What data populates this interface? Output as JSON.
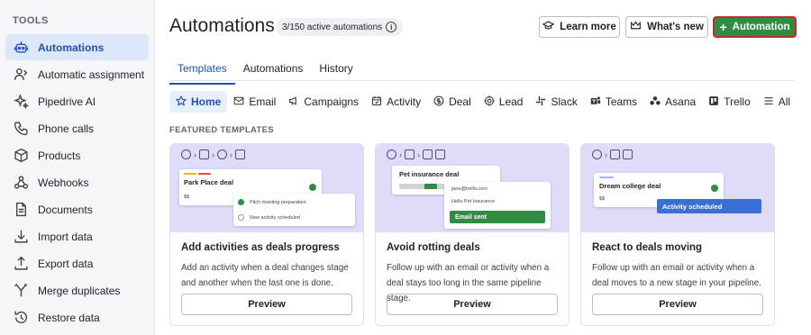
{
  "sidebar": {
    "section": "TOOLS",
    "items": [
      {
        "label": "Automations",
        "icon": "robot-icon",
        "active": true
      },
      {
        "label": "Automatic assignment",
        "icon": "assignment-icon"
      },
      {
        "label": "Pipedrive AI",
        "icon": "sparkle-icon"
      },
      {
        "label": "Phone calls",
        "icon": "phone-icon"
      },
      {
        "label": "Products",
        "icon": "box-icon"
      },
      {
        "label": "Webhooks",
        "icon": "webhook-icon"
      },
      {
        "label": "Documents",
        "icon": "document-icon"
      },
      {
        "label": "Import data",
        "icon": "import-icon"
      },
      {
        "label": "Export data",
        "icon": "export-icon"
      },
      {
        "label": "Merge duplicates",
        "icon": "merge-icon"
      },
      {
        "label": "Restore data",
        "icon": "restore-icon"
      }
    ]
  },
  "header": {
    "title": "Automations",
    "active_count": "3/150 active automations",
    "learn_more": "Learn more",
    "whats_new": "What's new",
    "add_automation": "Automation"
  },
  "tabs": [
    "Templates",
    "Automations",
    "History"
  ],
  "filters": [
    "Home",
    "Email",
    "Campaigns",
    "Activity",
    "Deal",
    "Lead",
    "Slack",
    "Teams",
    "Asana",
    "Trello",
    "All"
  ],
  "featured_label": "FEATURED TEMPLATES",
  "cards": [
    {
      "title": "Add activities as deals progress",
      "description": "Add an activity when a deal changes stage and another when the last one is done.",
      "button": "Preview",
      "illustration": {
        "deal": "Park Place deal",
        "amount": "$$",
        "activity1": "Pitch meeting preparation",
        "activity2": "New activity scheduled"
      }
    },
    {
      "title": "Avoid rotting deals",
      "description": "Follow up with an email or activity when a deal stays too long in the same pipeline stage.",
      "button": "Preview",
      "illustration": {
        "deal": "Pet insurance deal",
        "email_from": "jane@trello.com",
        "email_subject": "Hello Pet Insurance",
        "status": "Email sent"
      }
    },
    {
      "title": "React to deals moving",
      "description": "Follow up with an email or activity when a deal moves to a new stage in your pipeline.",
      "button": "Preview",
      "illustration": {
        "deal": "Dream college deal",
        "amount": "$$",
        "status": "Activity scheduled"
      }
    }
  ],
  "colors": {
    "accent": "#2151b5",
    "primary_button": "#2f8d42",
    "highlight_border": "#c42b2b",
    "illustration_bg": "#dfdcfa"
  }
}
